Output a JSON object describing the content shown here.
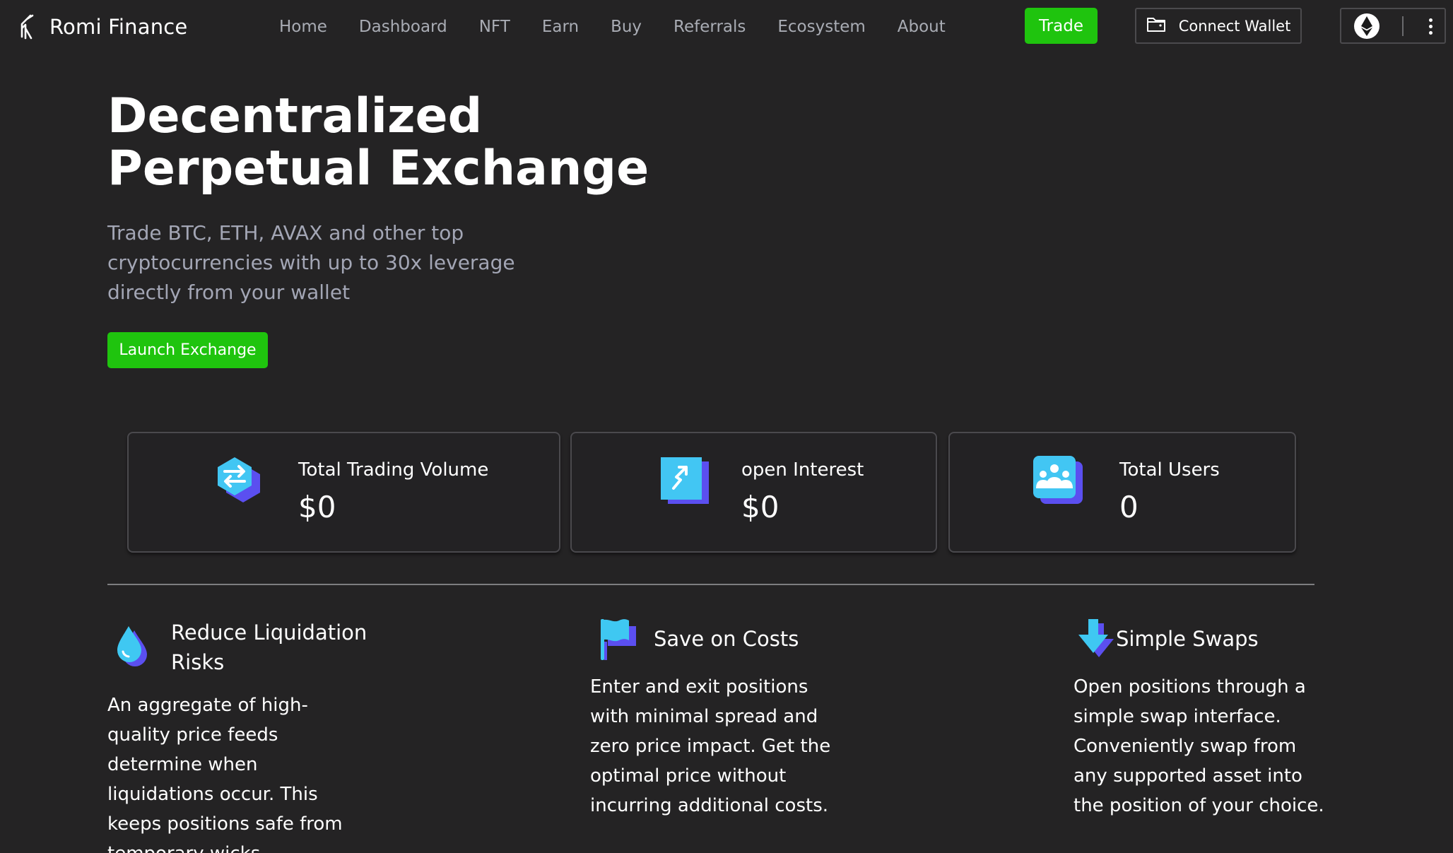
{
  "header": {
    "brand": "Romi Finance",
    "nav": [
      "Home",
      "Dashboard",
      "NFT",
      "Earn",
      "Buy",
      "Referrals",
      "Ecosystem",
      "About"
    ],
    "trade_label": "Trade",
    "connect_wallet_label": "Connect Wallet",
    "network_icon": "ethereum-icon",
    "more_icon": "more-vertical-icon"
  },
  "hero": {
    "title_line1": "Decentralized",
    "title_line2": "Perpetual Exchange",
    "subtitle": "Trade BTC, ETH, AVAX and other top cryptocurrencies with up to 30x leverage directly from your wallet",
    "launch_label": "Launch Exchange"
  },
  "stats": [
    {
      "label": "Total Trading Volume",
      "value": "$0",
      "icon": "swap-arrows-icon"
    },
    {
      "label": "open Interest",
      "value": "$0",
      "icon": "trend-arrow-icon"
    },
    {
      "label": "Total Users",
      "value": "0",
      "icon": "users-group-icon"
    }
  ],
  "features": [
    {
      "title": "Reduce Liquidation Risks",
      "text": "An aggregate of high-quality price feeds determine when liquidations occur. This keeps positions safe from temporary wicks.",
      "icon": "water-drop-icon"
    },
    {
      "title": "Save on Costs",
      "text": "Enter and exit positions with minimal spread and zero price impact. Get the optimal price without incurring additional costs.",
      "icon": "flag-icon"
    },
    {
      "title": "Simple Swaps",
      "text": "Open positions through a simple swap interface. Conveniently swap from any supported asset into the position of your choice.",
      "icon": "arrow-down-icon"
    }
  ],
  "colors": {
    "background": "#242324",
    "accent_green": "#1fc40e",
    "nav_text": "#a9acb4",
    "subtitle_text": "#a3a6b5",
    "icon_cyan": "#3fc8f2",
    "icon_purple": "#5b4ff0"
  }
}
